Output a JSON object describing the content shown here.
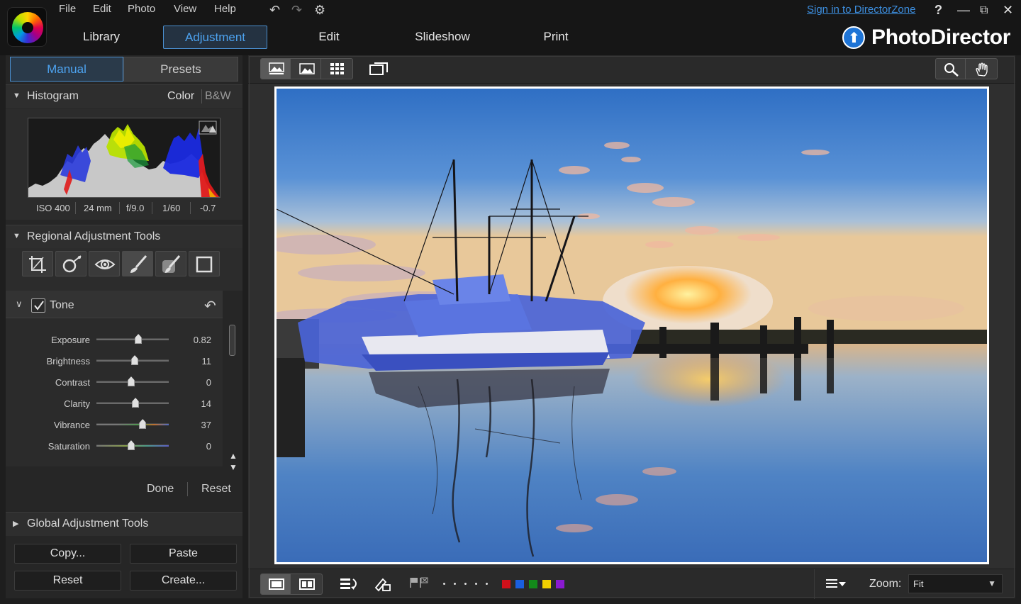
{
  "menu": {
    "file": "File",
    "edit": "Edit",
    "photo": "Photo",
    "view": "View",
    "help": "Help"
  },
  "nav": {
    "library": "Library",
    "adjustment": "Adjustment",
    "edit": "Edit",
    "slideshow": "Slideshow",
    "print": "Print"
  },
  "header": {
    "signin": "Sign in to DirectorZone",
    "help": "?",
    "brand": "PhotoDirector"
  },
  "left": {
    "tabs": {
      "manual": "Manual",
      "presets": "Presets"
    },
    "histogram": {
      "title": "Histogram",
      "color": "Color",
      "bw": "B&W",
      "exif": {
        "iso": "ISO 400",
        "focal": "24 mm",
        "aperture": "f/9.0",
        "shutter": "1/60",
        "ev": "-0.7"
      }
    },
    "regional": {
      "title": "Regional Adjustment Tools",
      "tools": [
        "crop-straighten-tool-icon",
        "spot-removal-tool-icon",
        "red-eye-tool-icon",
        "adjustment-brush-tool-icon",
        "gradient-mask-tool-icon",
        "frame-tool-icon"
      ]
    },
    "tone": {
      "label": "Tone",
      "checked": true,
      "sliders": [
        {
          "name": "Exposure",
          "value": "0.82",
          "pos": 0.58
        },
        {
          "name": "Brightness",
          "value": "11",
          "pos": 0.53
        },
        {
          "name": "Contrast",
          "value": "0",
          "pos": 0.48
        },
        {
          "name": "Clarity",
          "value": "14",
          "pos": 0.54
        },
        {
          "name": "Vibrance",
          "value": "37",
          "pos": 0.64
        },
        {
          "name": "Saturation",
          "value": "0",
          "pos": 0.48
        }
      ]
    },
    "done": "Done",
    "reset": "Reset",
    "global": {
      "title": "Global Adjustment Tools"
    },
    "buttons": {
      "copy": "Copy...",
      "paste": "Paste",
      "reset": "Reset",
      "create": "Create..."
    }
  },
  "bottom": {
    "zoom_label": "Zoom:",
    "zoom_value": "Fit",
    "color_labels": [
      "#d0101a",
      "#1a5fe0",
      "#138a1a",
      "#f0d000",
      "#8a1ad0"
    ]
  },
  "colors": {
    "accent": "#4da3f0",
    "bg": "#1e1e1e"
  }
}
